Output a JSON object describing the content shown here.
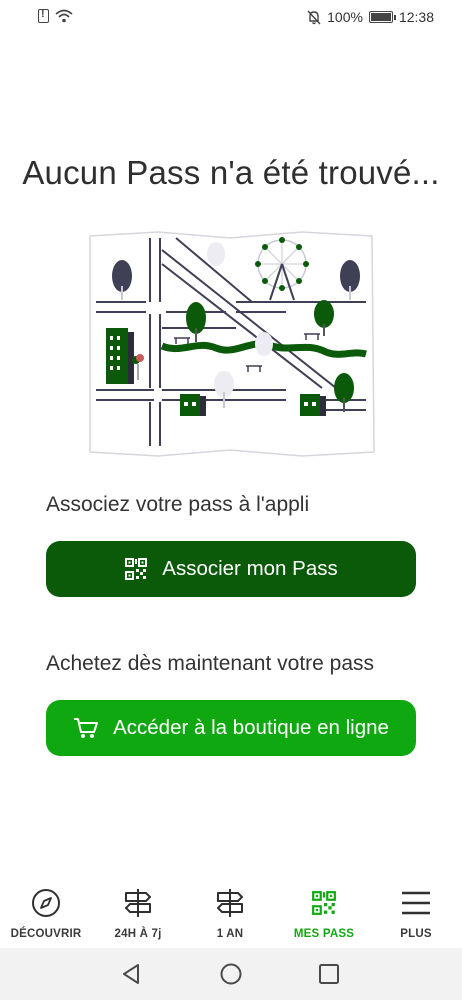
{
  "status_bar": {
    "battery_percent": "100%",
    "time": "12:38"
  },
  "empty_state": {
    "title": "Aucun Pass n'a été trouvé..."
  },
  "associate": {
    "prompt": "Associez votre pass à l'appli",
    "button_label": "Associer mon Pass",
    "button_icon": "qr-code-icon"
  },
  "shop": {
    "prompt": "Achetez dès maintenant votre pass",
    "button_label": "Accéder à la boutique en ligne",
    "button_icon": "cart-icon"
  },
  "bottom_nav": {
    "items": [
      {
        "label": "DÉCOUVRIR",
        "icon": "compass-icon",
        "active": false
      },
      {
        "label": "24H À 7j",
        "icon": "signpost-icon",
        "active": false
      },
      {
        "label": "1 AN",
        "icon": "signpost-icon",
        "active": false
      },
      {
        "label": "MES PASS",
        "icon": "qr-code-icon",
        "active": true
      },
      {
        "label": "PLUS",
        "icon": "menu-icon",
        "active": false
      }
    ]
  },
  "colors": {
    "primary_dark_green": "#0a5a0a",
    "primary_green": "#10a810",
    "text": "#2f2f2f"
  }
}
